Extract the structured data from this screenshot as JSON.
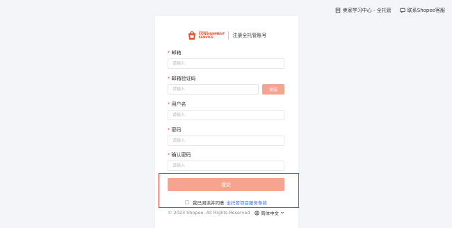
{
  "topbar": {
    "learning_center": "卖家学习中心 - 全托管",
    "contact_service": "联系Shopee客服"
  },
  "logo": {
    "brand_small": "Shopee",
    "brand_line1": "CONSIGNMENT",
    "brand_line2": "SERVICE",
    "page_title": "注册全托管账号"
  },
  "form": {
    "email": {
      "label": "邮箱",
      "required": "*",
      "placeholder": "请输入"
    },
    "email_code": {
      "label": "邮箱验证码",
      "required": "*",
      "placeholder": "请输入",
      "send_label": "发送"
    },
    "username": {
      "label": "用户名",
      "required": "*",
      "placeholder": "请输入"
    },
    "password": {
      "label": "密码",
      "required": "*",
      "placeholder": "请输入"
    },
    "confirm_password": {
      "label": "确认密码",
      "required": "*",
      "placeholder": "请输入"
    },
    "submit_label": "提交",
    "agree_text": "我已阅读并同意",
    "terms_link": "全托管项目服务条款"
  },
  "footer": {
    "copyright": "© 2023 Shopee. All Rights Reserved",
    "language": "简体中文"
  },
  "colors": {
    "accent": "#ee4d2d",
    "button_disabled": "#f6a490",
    "link": "#3a6fe0",
    "highlight_border": "#e03a2f"
  }
}
